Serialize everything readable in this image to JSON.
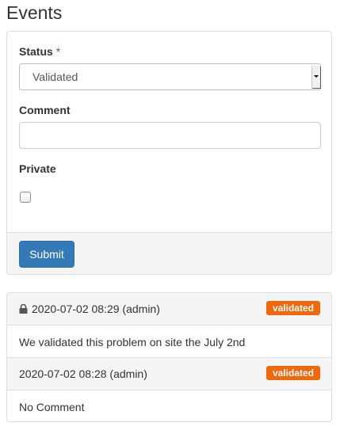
{
  "page": {
    "title": "Events"
  },
  "form": {
    "status_label": "Status",
    "required_marker": "*",
    "status_selected": "Validated",
    "comment_label": "Comment",
    "comment_value": "",
    "private_label": "Private",
    "private_checked": false,
    "submit_label": "Submit"
  },
  "events": [
    {
      "private": true,
      "icon": "lock-icon",
      "meta": "2020-07-02 08:29 (admin)",
      "badge": "validated",
      "text": "We validated this problem on site the July 2nd"
    },
    {
      "private": false,
      "meta": "2020-07-02 08:28 (admin)",
      "badge": "validated",
      "text": "No Comment"
    }
  ],
  "colors": {
    "primary": "#337ab7",
    "badge": "#f0680a",
    "required": "#a94442"
  }
}
